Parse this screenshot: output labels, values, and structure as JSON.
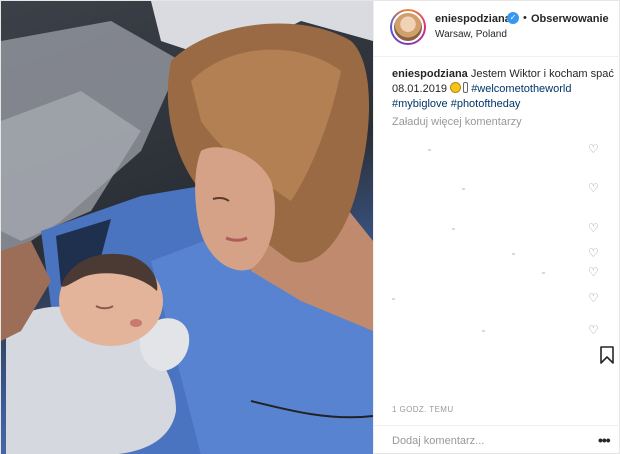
{
  "header": {
    "username": "eniespodziana",
    "dot": "•",
    "follow_label": "Obserwowanie",
    "location": "Warsaw, Poland",
    "verified_glyph": "✓"
  },
  "caption": {
    "username": "eniespodziana",
    "text_part1": " Jestem Wiktor i kocham spać 08.01.2019 ",
    "hashtag1": "#welcometotheworld",
    "hashtag2": "#mybiglove",
    "hashtag3": "#photoftheday"
  },
  "load_more_label": "Załaduj więcej komentarzy",
  "heart_glyph": "♡",
  "timestamp": "1 GODZ. TEMU",
  "comment_box": {
    "placeholder": "Dodaj komentarz...",
    "more_glyph": "•••"
  },
  "colors": {
    "hashtag": "#003569",
    "verified": "#3897f0",
    "muted": "#999999"
  },
  "icons": [
    "verified-badge-icon",
    "heart-icon",
    "bookmark-icon",
    "more-options-icon",
    "emoji-icon",
    "baby-bottle-icon"
  ]
}
